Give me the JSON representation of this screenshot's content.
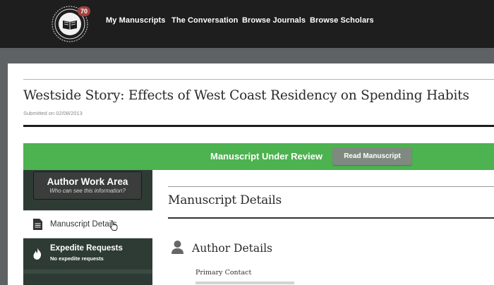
{
  "header": {
    "badge_count": "70",
    "nav": [
      "My Manuscripts",
      "The Conversation",
      "Browse Journals",
      "Browse Scholars"
    ]
  },
  "manuscript": {
    "title": "Westside Story: Effects of West Coast Residency on Spending Habits",
    "submitted": "Submitted on 02/08/2013"
  },
  "status_bar": {
    "status": "Manuscript Under Review",
    "read_button": "Read Manuscript",
    "color": "#4db250"
  },
  "sidebar": {
    "work_area_title": "Author Work Area",
    "work_area_sub": "Who can see this information?",
    "items": [
      {
        "label": "Manuscript Details",
        "icon": "document-icon"
      },
      {
        "label": "Expedite Requests",
        "sub": "No expedite requests",
        "icon": "flame-icon"
      }
    ]
  },
  "main": {
    "section_title": "Manuscript Details",
    "subsection_title": "Author Details",
    "primary_contact_label": "Primary Contact"
  }
}
